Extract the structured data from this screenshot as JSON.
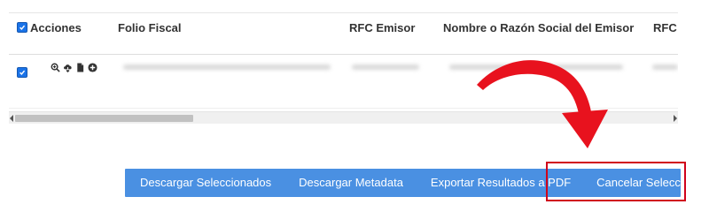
{
  "table": {
    "headers": {
      "acciones": "Acciones",
      "folio_fiscal": "Folio Fiscal",
      "rfc_emisor": "RFC Emisor",
      "nombre_emisor": "Nombre o Razón Social del Emisor",
      "rfc_receptor": "RFC"
    },
    "select_all_checked": true,
    "rows": [
      {
        "checked": true,
        "actions": [
          "zoom-in-icon",
          "cloud-download-icon",
          "document-icon",
          "add-circle-icon"
        ]
      }
    ]
  },
  "buttons": {
    "descargar_seleccionados": "Descargar Seleccionados",
    "descargar_metadata": "Descargar Metadata",
    "exportar_pdf": "Exportar Resultados a PDF",
    "cancelar_seleccionados": "Cancelar Seleccionados"
  },
  "colors": {
    "button_bar": "#4a90e2",
    "highlight": "#d0021b",
    "arrow": "#e8121e",
    "checkbox": "#1a73e8"
  }
}
